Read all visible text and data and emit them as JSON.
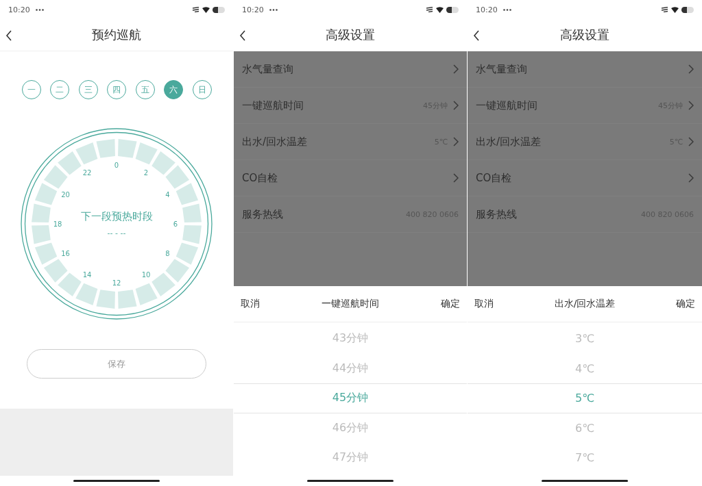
{
  "panels": [
    {
      "kind": "schedule",
      "status_time": "10:20",
      "title": "预约巡航",
      "days": [
        {
          "label": "一",
          "selected": false
        },
        {
          "label": "二",
          "selected": false
        },
        {
          "label": "三",
          "selected": false
        },
        {
          "label": "四",
          "selected": false
        },
        {
          "label": "五",
          "selected": false
        },
        {
          "label": "六",
          "selected": true
        },
        {
          "label": "日",
          "selected": false
        }
      ],
      "dial": {
        "hour_labels": [
          "0",
          "2",
          "4",
          "6",
          "8",
          "10",
          "12",
          "14",
          "16",
          "18",
          "20",
          "22"
        ],
        "caption": "下一段预热时段",
        "value": "-- - --"
      },
      "save_button": "保存"
    },
    {
      "kind": "settings",
      "status_time": "10:20",
      "title": "高级设置",
      "settings": [
        {
          "label": "水气量查询",
          "chevron": true
        },
        {
          "label": "一键巡航时间",
          "value": "45分钟",
          "chevron": true
        },
        {
          "label": "出水/回水温差",
          "value": "5℃",
          "chevron": true
        },
        {
          "label": "CO自检",
          "chevron": true
        },
        {
          "label": "服务热线",
          "value": "400 820 0606",
          "chevron": false
        }
      ],
      "picker": {
        "cancel": "取消",
        "title": "一键巡航时间",
        "confirm": "确定",
        "options": [
          {
            "label": "43分钟",
            "selected": false
          },
          {
            "label": "44分钟",
            "selected": false
          },
          {
            "label": "45分钟",
            "selected": true
          },
          {
            "label": "46分钟",
            "selected": false
          },
          {
            "label": "47分钟",
            "selected": false
          }
        ]
      }
    },
    {
      "kind": "settings",
      "status_time": "10:20",
      "title": "高级设置",
      "settings": [
        {
          "label": "水气量查询",
          "chevron": true
        },
        {
          "label": "一键巡航时间",
          "value": "45分钟",
          "chevron": true
        },
        {
          "label": "出水/回水温差",
          "value": "5℃",
          "chevron": true
        },
        {
          "label": "CO自检",
          "chevron": true
        },
        {
          "label": "服务热线",
          "value": "400 820 0606",
          "chevron": false
        }
      ],
      "picker": {
        "cancel": "取消",
        "title": "出水/回水温差",
        "confirm": "确定",
        "options": [
          {
            "label": "3℃",
            "selected": false
          },
          {
            "label": "4℃",
            "selected": false
          },
          {
            "label": "5℃",
            "selected": true
          },
          {
            "label": "6℃",
            "selected": false
          },
          {
            "label": "7℃",
            "selected": false
          }
        ]
      }
    }
  ]
}
